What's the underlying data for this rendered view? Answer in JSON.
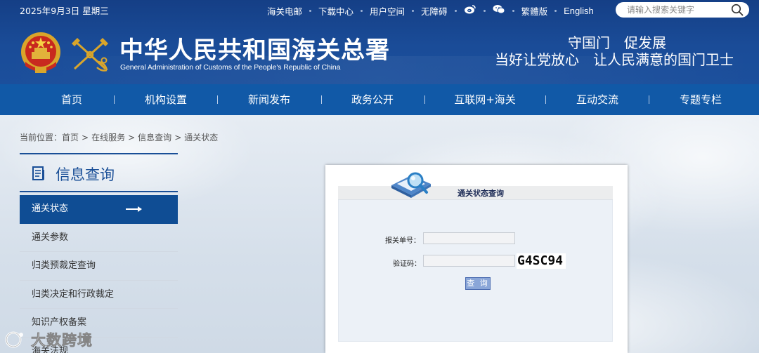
{
  "header": {
    "date": "2025年9月3日 星期三",
    "top_links": [
      "海关电邮",
      "下载中心",
      "用户空间",
      "无障碍"
    ],
    "social_icons": [
      "weibo-icon",
      "wechat-icon"
    ],
    "lang_links": [
      "繁體版",
      "English"
    ],
    "search_placeholder": "请输入搜索关键字",
    "title_cn": "中华人民共和国海关总署",
    "title_en": "General Administration of Customs of the People's Republic of China",
    "slogan_line1": "守国门　促发展",
    "slogan_line2": "当好让党放心　让人民满意的国门卫士",
    "colors": {
      "header_bg": "#1a4c98",
      "nav_bg": "#1159a7",
      "accent": "#0f4d94"
    }
  },
  "nav": {
    "items": [
      "首页",
      "机构设置",
      "新闻发布",
      "政务公开",
      "互联网+海关",
      "互动交流",
      "专题专栏"
    ]
  },
  "breadcrumb": {
    "prefix": "当前位置：",
    "items": [
      "首页",
      "在线服务",
      "信息查询",
      "通关状态"
    ]
  },
  "sidebar": {
    "title": "信息查询",
    "items": [
      {
        "label": "通关状态",
        "active": true
      },
      {
        "label": "通关参数",
        "active": false
      },
      {
        "label": "归类预裁定查询",
        "active": false
      },
      {
        "label": "归类决定和行政裁定",
        "active": false
      },
      {
        "label": "知识产权备案",
        "active": false
      },
      {
        "label": "海关法规",
        "active": false
      }
    ]
  },
  "query": {
    "title": "通关状态查询",
    "declaration_label": "报关单号：",
    "declaration_value": "",
    "captcha_label": "验证码：",
    "captcha_value": "",
    "captcha_text": "G4SC94",
    "submit_label": "查 询"
  },
  "watermark": {
    "text": "大数跨境"
  }
}
